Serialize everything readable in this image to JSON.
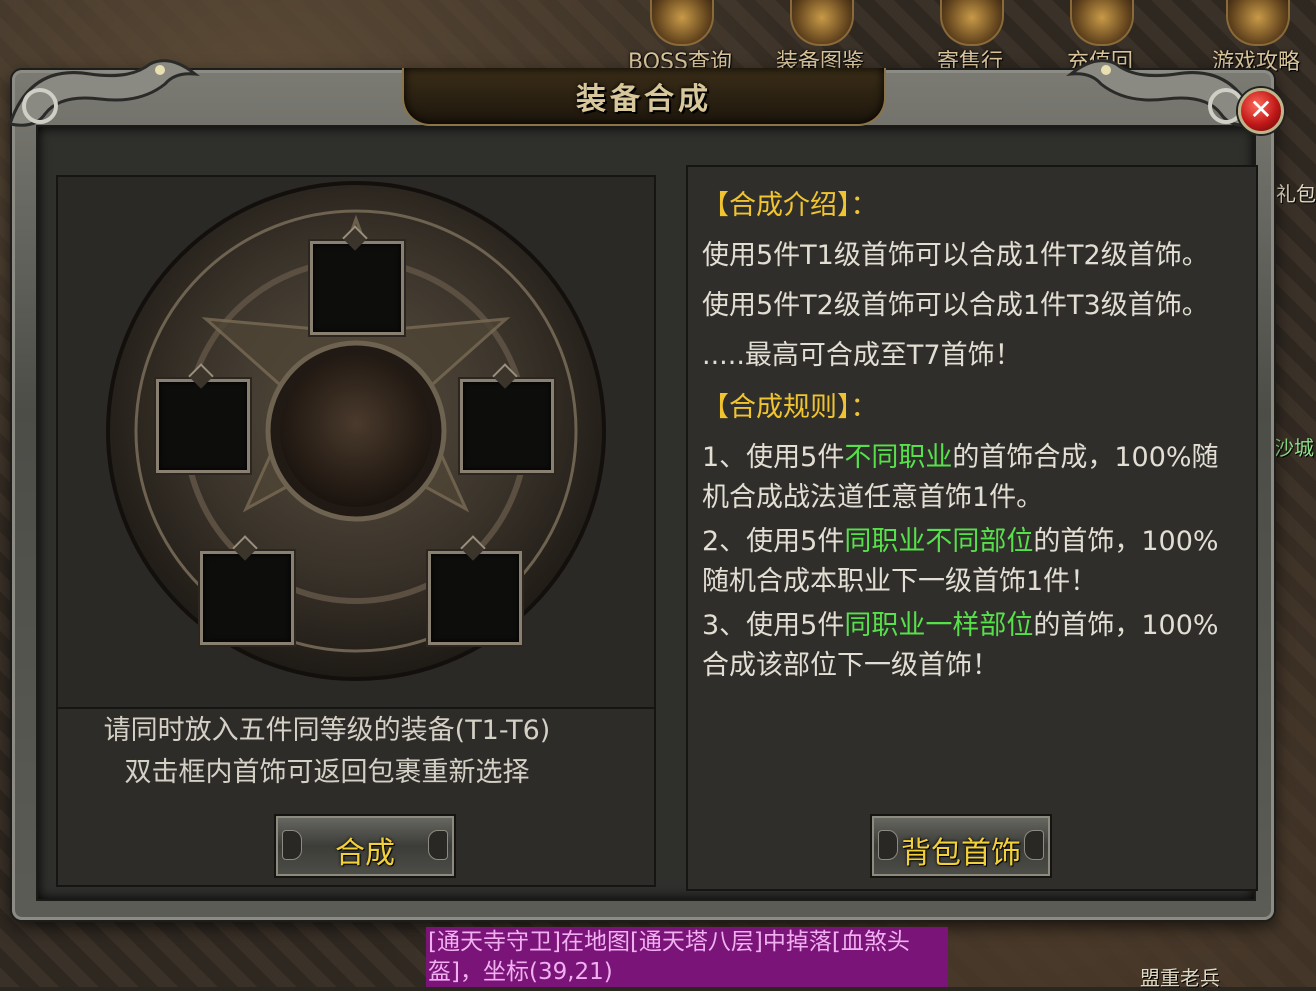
{
  "top_menu": [
    {
      "label": "BOSS查询"
    },
    {
      "label": "装备图鉴"
    },
    {
      "label": "寄售行"
    },
    {
      "label": "充值回"
    },
    {
      "label": "游戏攻略"
    }
  ],
  "side_labels": {
    "right_a": "礼包",
    "right_b": "沙城",
    "bottom_right": "盟重老兵"
  },
  "dialog": {
    "title": "装备合成",
    "close_glyph": "✕",
    "hints": [
      "请同时放入五件同等级的装备(T1-T6)",
      "双击框内首饰可返回包裹重新选择"
    ],
    "synth_button": "合成",
    "bag_button": "背包首饰",
    "intro": {
      "heading": "【合成介绍】：",
      "lines": [
        "使用5件T1级首饰可以合成1件T2级首饰。",
        "使用5件T2级首饰可以合成1件T3级首饰。",
        ".....最高可合成至T7首饰！"
      ]
    },
    "rules": {
      "heading": "【合成规则】：",
      "items": [
        {
          "prefix": "1、使用5件",
          "highlight": "不同职业",
          "suffix": "的首饰合成，100%随",
          "line2": "机合成战法道任意首饰1件。"
        },
        {
          "prefix": "2、使用5件",
          "highlight": "同职业不同部位",
          "suffix": "的首饰，100%",
          "line2": "随机合成本职业下一级首饰1件！"
        },
        {
          "prefix": "3、使用5件",
          "highlight": "同职业一样部位",
          "suffix": "的首饰，100%",
          "line2": "合成该部位下一级首饰！"
        }
      ]
    }
  },
  "chat": {
    "line1": "[通天寺守卫]在地图[通天塔八层]中掉落[血煞头",
    "line2": "盔]，坐标(39,21)"
  },
  "colors": {
    "accent_yellow": "#f0c430",
    "highlight_green": "#56e04a",
    "chat_bg": "#7a1478"
  }
}
